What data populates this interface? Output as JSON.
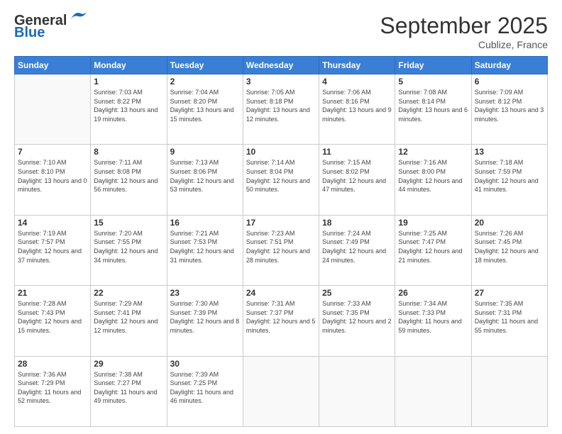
{
  "header": {
    "logo_general": "General",
    "logo_blue": "Blue",
    "month_title": "September 2025",
    "location": "Cublize, France"
  },
  "weekdays": [
    "Sunday",
    "Monday",
    "Tuesday",
    "Wednesday",
    "Thursday",
    "Friday",
    "Saturday"
  ],
  "weeks": [
    [
      {
        "day": "",
        "sunrise": "",
        "sunset": "",
        "daylight": ""
      },
      {
        "day": "1",
        "sunrise": "Sunrise: 7:03 AM",
        "sunset": "Sunset: 8:22 PM",
        "daylight": "Daylight: 13 hours and 19 minutes."
      },
      {
        "day": "2",
        "sunrise": "Sunrise: 7:04 AM",
        "sunset": "Sunset: 8:20 PM",
        "daylight": "Daylight: 13 hours and 15 minutes."
      },
      {
        "day": "3",
        "sunrise": "Sunrise: 7:05 AM",
        "sunset": "Sunset: 8:18 PM",
        "daylight": "Daylight: 13 hours and 12 minutes."
      },
      {
        "day": "4",
        "sunrise": "Sunrise: 7:06 AM",
        "sunset": "Sunset: 8:16 PM",
        "daylight": "Daylight: 13 hours and 9 minutes."
      },
      {
        "day": "5",
        "sunrise": "Sunrise: 7:08 AM",
        "sunset": "Sunset: 8:14 PM",
        "daylight": "Daylight: 13 hours and 6 minutes."
      },
      {
        "day": "6",
        "sunrise": "Sunrise: 7:09 AM",
        "sunset": "Sunset: 8:12 PM",
        "daylight": "Daylight: 13 hours and 3 minutes."
      }
    ],
    [
      {
        "day": "7",
        "sunrise": "Sunrise: 7:10 AM",
        "sunset": "Sunset: 8:10 PM",
        "daylight": "Daylight: 13 hours and 0 minutes."
      },
      {
        "day": "8",
        "sunrise": "Sunrise: 7:11 AM",
        "sunset": "Sunset: 8:08 PM",
        "daylight": "Daylight: 12 hours and 56 minutes."
      },
      {
        "day": "9",
        "sunrise": "Sunrise: 7:13 AM",
        "sunset": "Sunset: 8:06 PM",
        "daylight": "Daylight: 12 hours and 53 minutes."
      },
      {
        "day": "10",
        "sunrise": "Sunrise: 7:14 AM",
        "sunset": "Sunset: 8:04 PM",
        "daylight": "Daylight: 12 hours and 50 minutes."
      },
      {
        "day": "11",
        "sunrise": "Sunrise: 7:15 AM",
        "sunset": "Sunset: 8:02 PM",
        "daylight": "Daylight: 12 hours and 47 minutes."
      },
      {
        "day": "12",
        "sunrise": "Sunrise: 7:16 AM",
        "sunset": "Sunset: 8:00 PM",
        "daylight": "Daylight: 12 hours and 44 minutes."
      },
      {
        "day": "13",
        "sunrise": "Sunrise: 7:18 AM",
        "sunset": "Sunset: 7:59 PM",
        "daylight": "Daylight: 12 hours and 41 minutes."
      }
    ],
    [
      {
        "day": "14",
        "sunrise": "Sunrise: 7:19 AM",
        "sunset": "Sunset: 7:57 PM",
        "daylight": "Daylight: 12 hours and 37 minutes."
      },
      {
        "day": "15",
        "sunrise": "Sunrise: 7:20 AM",
        "sunset": "Sunset: 7:55 PM",
        "daylight": "Daylight: 12 hours and 34 minutes."
      },
      {
        "day": "16",
        "sunrise": "Sunrise: 7:21 AM",
        "sunset": "Sunset: 7:53 PM",
        "daylight": "Daylight: 12 hours and 31 minutes."
      },
      {
        "day": "17",
        "sunrise": "Sunrise: 7:23 AM",
        "sunset": "Sunset: 7:51 PM",
        "daylight": "Daylight: 12 hours and 28 minutes."
      },
      {
        "day": "18",
        "sunrise": "Sunrise: 7:24 AM",
        "sunset": "Sunset: 7:49 PM",
        "daylight": "Daylight: 12 hours and 24 minutes."
      },
      {
        "day": "19",
        "sunrise": "Sunrise: 7:25 AM",
        "sunset": "Sunset: 7:47 PM",
        "daylight": "Daylight: 12 hours and 21 minutes."
      },
      {
        "day": "20",
        "sunrise": "Sunrise: 7:26 AM",
        "sunset": "Sunset: 7:45 PM",
        "daylight": "Daylight: 12 hours and 18 minutes."
      }
    ],
    [
      {
        "day": "21",
        "sunrise": "Sunrise: 7:28 AM",
        "sunset": "Sunset: 7:43 PM",
        "daylight": "Daylight: 12 hours and 15 minutes."
      },
      {
        "day": "22",
        "sunrise": "Sunrise: 7:29 AM",
        "sunset": "Sunset: 7:41 PM",
        "daylight": "Daylight: 12 hours and 12 minutes."
      },
      {
        "day": "23",
        "sunrise": "Sunrise: 7:30 AM",
        "sunset": "Sunset: 7:39 PM",
        "daylight": "Daylight: 12 hours and 8 minutes."
      },
      {
        "day": "24",
        "sunrise": "Sunrise: 7:31 AM",
        "sunset": "Sunset: 7:37 PM",
        "daylight": "Daylight: 12 hours and 5 minutes."
      },
      {
        "day": "25",
        "sunrise": "Sunrise: 7:33 AM",
        "sunset": "Sunset: 7:35 PM",
        "daylight": "Daylight: 12 hours and 2 minutes."
      },
      {
        "day": "26",
        "sunrise": "Sunrise: 7:34 AM",
        "sunset": "Sunset: 7:33 PM",
        "daylight": "Daylight: 11 hours and 59 minutes."
      },
      {
        "day": "27",
        "sunrise": "Sunrise: 7:35 AM",
        "sunset": "Sunset: 7:31 PM",
        "daylight": "Daylight: 11 hours and 55 minutes."
      }
    ],
    [
      {
        "day": "28",
        "sunrise": "Sunrise: 7:36 AM",
        "sunset": "Sunset: 7:29 PM",
        "daylight": "Daylight: 11 hours and 52 minutes."
      },
      {
        "day": "29",
        "sunrise": "Sunrise: 7:38 AM",
        "sunset": "Sunset: 7:27 PM",
        "daylight": "Daylight: 11 hours and 49 minutes."
      },
      {
        "day": "30",
        "sunrise": "Sunrise: 7:39 AM",
        "sunset": "Sunset: 7:25 PM",
        "daylight": "Daylight: 11 hours and 46 minutes."
      },
      {
        "day": "",
        "sunrise": "",
        "sunset": "",
        "daylight": ""
      },
      {
        "day": "",
        "sunrise": "",
        "sunset": "",
        "daylight": ""
      },
      {
        "day": "",
        "sunrise": "",
        "sunset": "",
        "daylight": ""
      },
      {
        "day": "",
        "sunrise": "",
        "sunset": "",
        "daylight": ""
      }
    ]
  ]
}
